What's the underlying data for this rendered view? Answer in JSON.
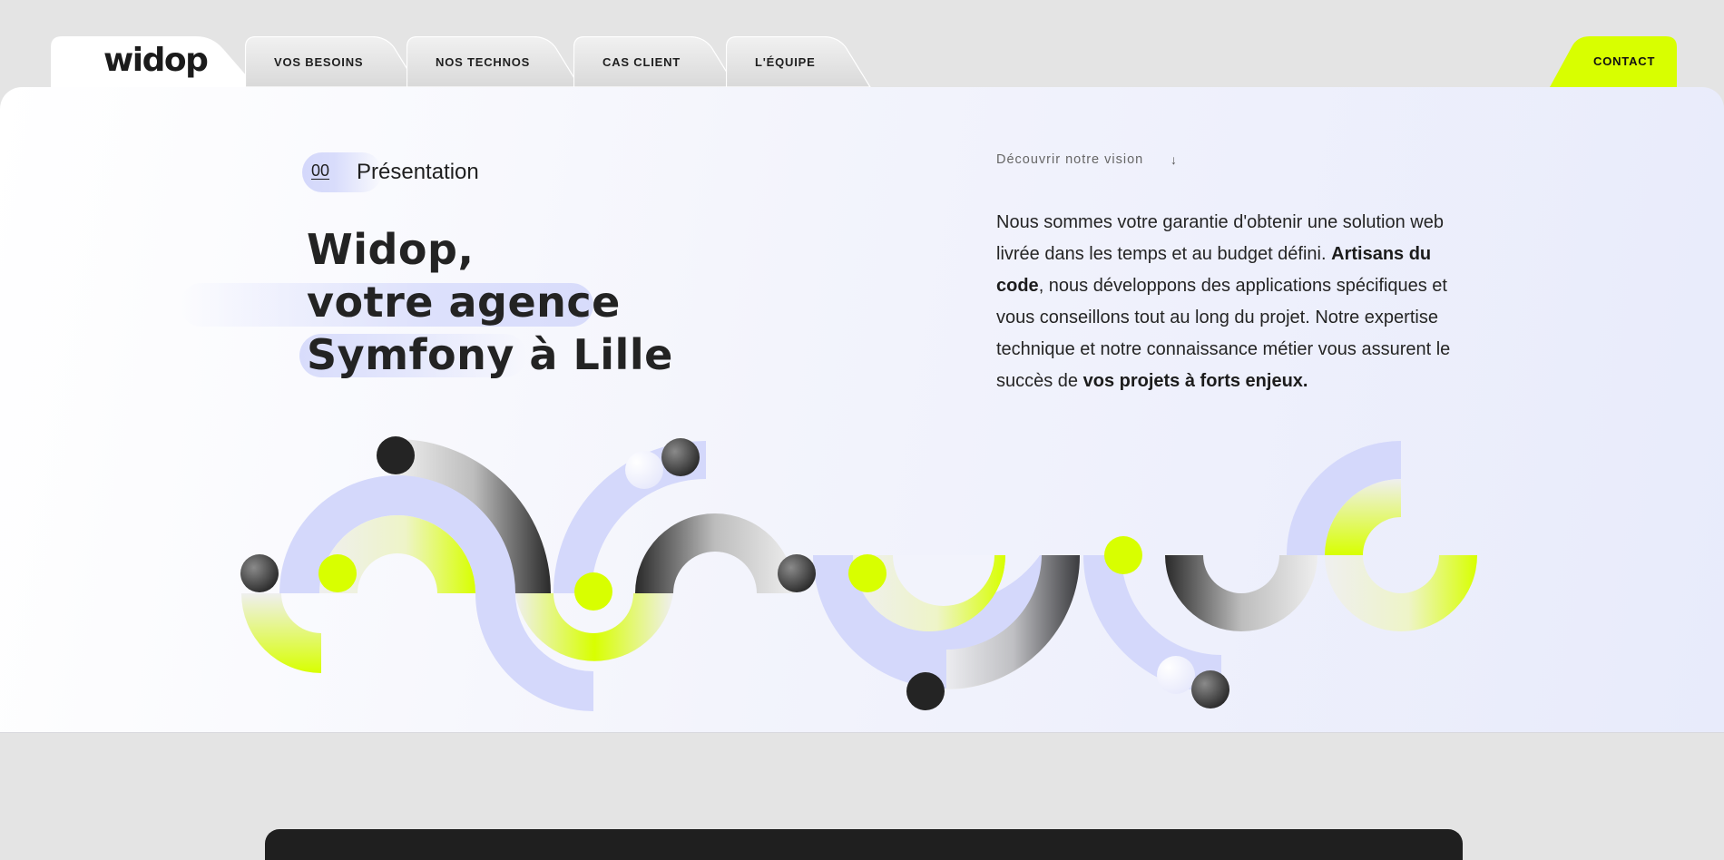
{
  "header": {
    "logo": "widop",
    "nav": [
      {
        "label": "VOS BESOINS"
      },
      {
        "label": "NOS TECHNOS"
      },
      {
        "label": "CAS CLIENT"
      },
      {
        "label": "L'ÉQUIPE"
      }
    ],
    "contact_label": "CONTACT"
  },
  "hero": {
    "tag_number": "00",
    "tag_label": "Présentation",
    "title_lines": [
      "Widop,",
      "votre agence",
      "Symfony à Lille"
    ],
    "vision_link": "Découvrir notre vision",
    "vision_arrow": "↓",
    "intro": {
      "p1": "Nous sommes votre garantie d'obtenir une solution web livrée dans les temps et au budget défini.",
      "p2_bold": "Artisans du code",
      "p2_rest": ", nous développons des applications spécifiques et vous conseillons tout au long du projet. Notre expertise technique et notre connaissance métier vous assurent le succès de ",
      "p2_bold_end": "vos projets à forts enjeux."
    }
  },
  "colors": {
    "accent_lime": "#d8ff00",
    "lavender": "#d4d8fb",
    "dark": "#1f1f1f",
    "background": "#e4e4e4"
  }
}
